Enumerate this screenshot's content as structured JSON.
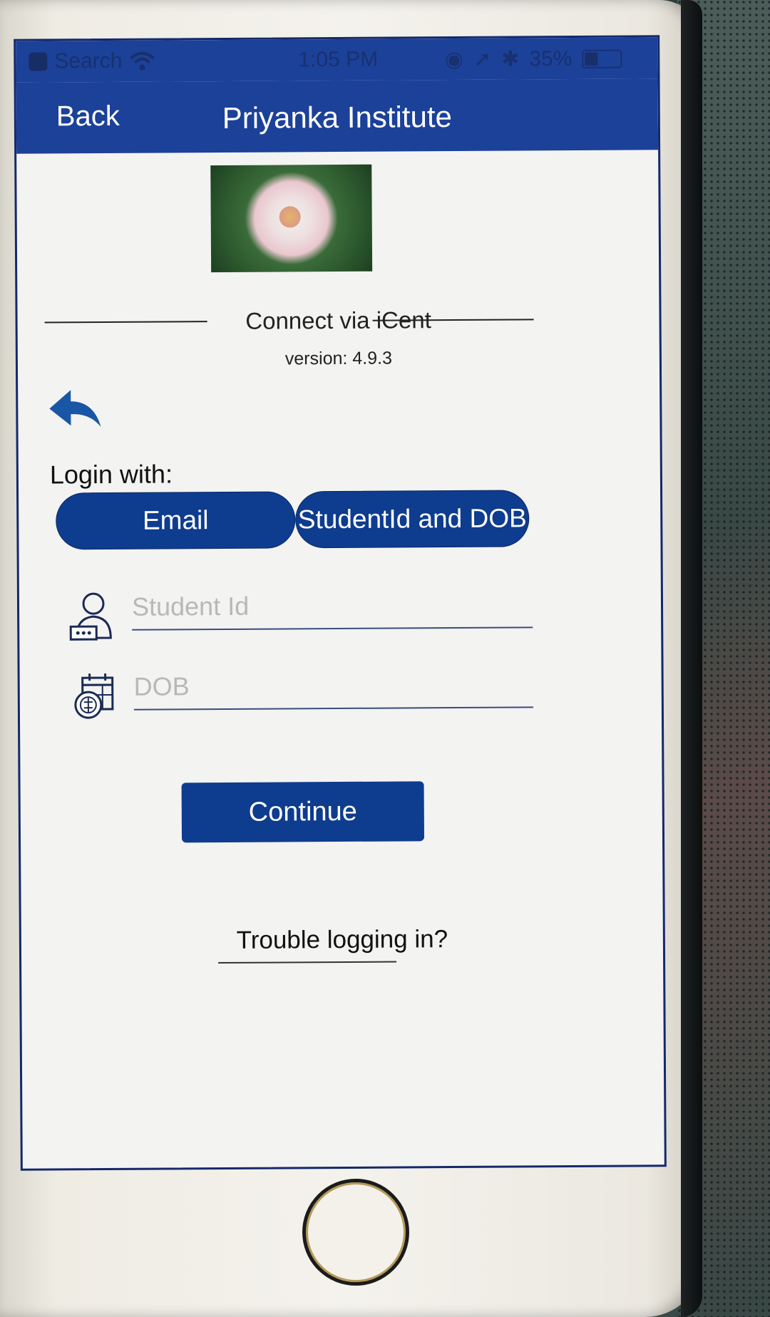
{
  "status_bar": {
    "back_app": "Search",
    "time": "1:05 PM",
    "battery": "35%"
  },
  "nav": {
    "back_label": "Back",
    "title": "Priyanka Institute"
  },
  "header": {
    "connect_label": "Connect via iCent",
    "version": "version: 4.9.3"
  },
  "login": {
    "label": "Login with:",
    "tab_email": "Email",
    "tab_studentid": "StudentId and DOB"
  },
  "fields": {
    "student_id_placeholder": "Student Id",
    "dob_placeholder": "DOB"
  },
  "actions": {
    "continue_label": "Continue",
    "trouble_label": "Trouble logging in?"
  },
  "colors": {
    "brand_blue": "#1c4199",
    "button_blue": "#0e3c8e"
  }
}
